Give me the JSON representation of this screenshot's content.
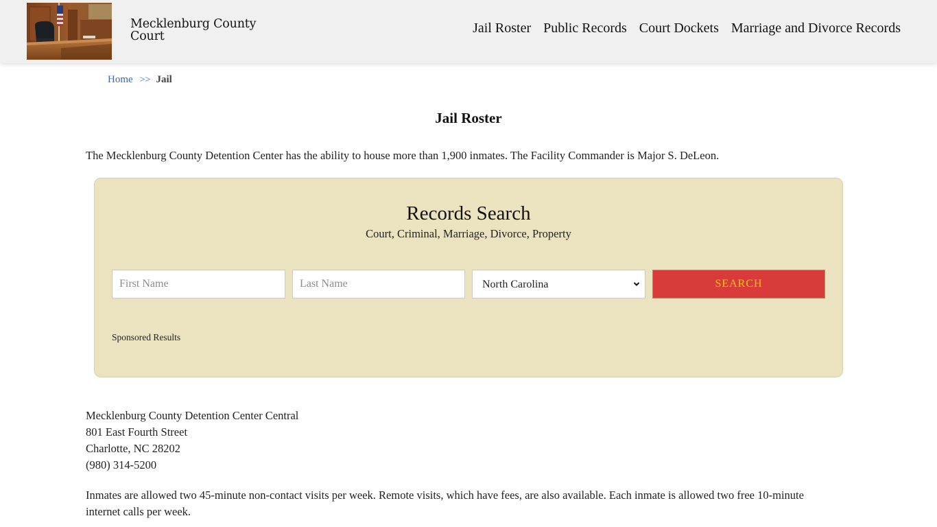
{
  "header": {
    "logo_alt": "Courtroom image",
    "site_title_line1": "Mecklenburg County",
    "site_title_line2": "Court",
    "nav": [
      {
        "label": "Jail Roster"
      },
      {
        "label": "Public Records"
      },
      {
        "label": "Court Dockets"
      },
      {
        "label": "Marriage and Divorce Records"
      }
    ]
  },
  "breadcrumb": {
    "home": "Home",
    "separator": ">>",
    "current": "Jail"
  },
  "page": {
    "title": "Jail Roster",
    "intro": "The Mecklenburg County Detention Center has the ability to house more than 1,900 inmates. The Facility Commander is Major S. DeLeon."
  },
  "search": {
    "title": "Records Search",
    "subtitle": "Court, Criminal, Marriage, Divorce, Property",
    "first_name_placeholder": "First Name",
    "last_name_placeholder": "Last Name",
    "state_selected": "North Carolina",
    "button_label": "SEARCH",
    "sponsored_label": "Sponsored Results",
    "colors": {
      "panel_bg": "#ebe3bf",
      "button_bg": "#d93a3a",
      "button_text": "#f5c518"
    }
  },
  "address": {
    "name": "Mecklenburg County Detention Center Central",
    "street": "801 East Fourth Street",
    "city_state_zip": "Charlotte, NC 28202",
    "phone": "(980) 314-5200"
  },
  "visits_text": "Inmates are allowed two 45-minute non-contact visits per week. Remote visits, which have fees, are also available. Each inmate is allowed two free 10-minute internet calls per week."
}
